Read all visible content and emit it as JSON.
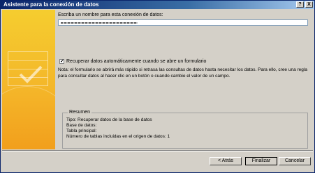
{
  "window": {
    "title": "Asistente para la conexión de datos",
    "help_button": "?",
    "close_button": "X"
  },
  "form": {
    "name_label": "Escriba un nombre para esta conexión de datos:",
    "checkbox_label": "Recuperar datos automáticamente cuando se abre un formulario",
    "checkbox_checked": "✓",
    "note_text": "Nota: el formulario se abrirá más rápido si retrasa las consultas de datos hasta necesitar los datos. Para ello, cree una regla para consultar datos al hacer clic en un botón o cuando cambie el valor de un campo."
  },
  "summary": {
    "title": "Resumen",
    "lines": [
      "Tipo: Recuperar datos de la base de datos",
      "Base de datos:",
      "Tabla principal:",
      "Número de tablas incluidas en el origen de datos: 1"
    ]
  },
  "buttons": {
    "back": "< Atrás",
    "finish": "Finalizar",
    "cancel": "Cancelar"
  },
  "colors": {
    "titlebar": "#0a246a",
    "side_panel": "#f4b72a",
    "dialog_bg": "#d4d0c8"
  }
}
